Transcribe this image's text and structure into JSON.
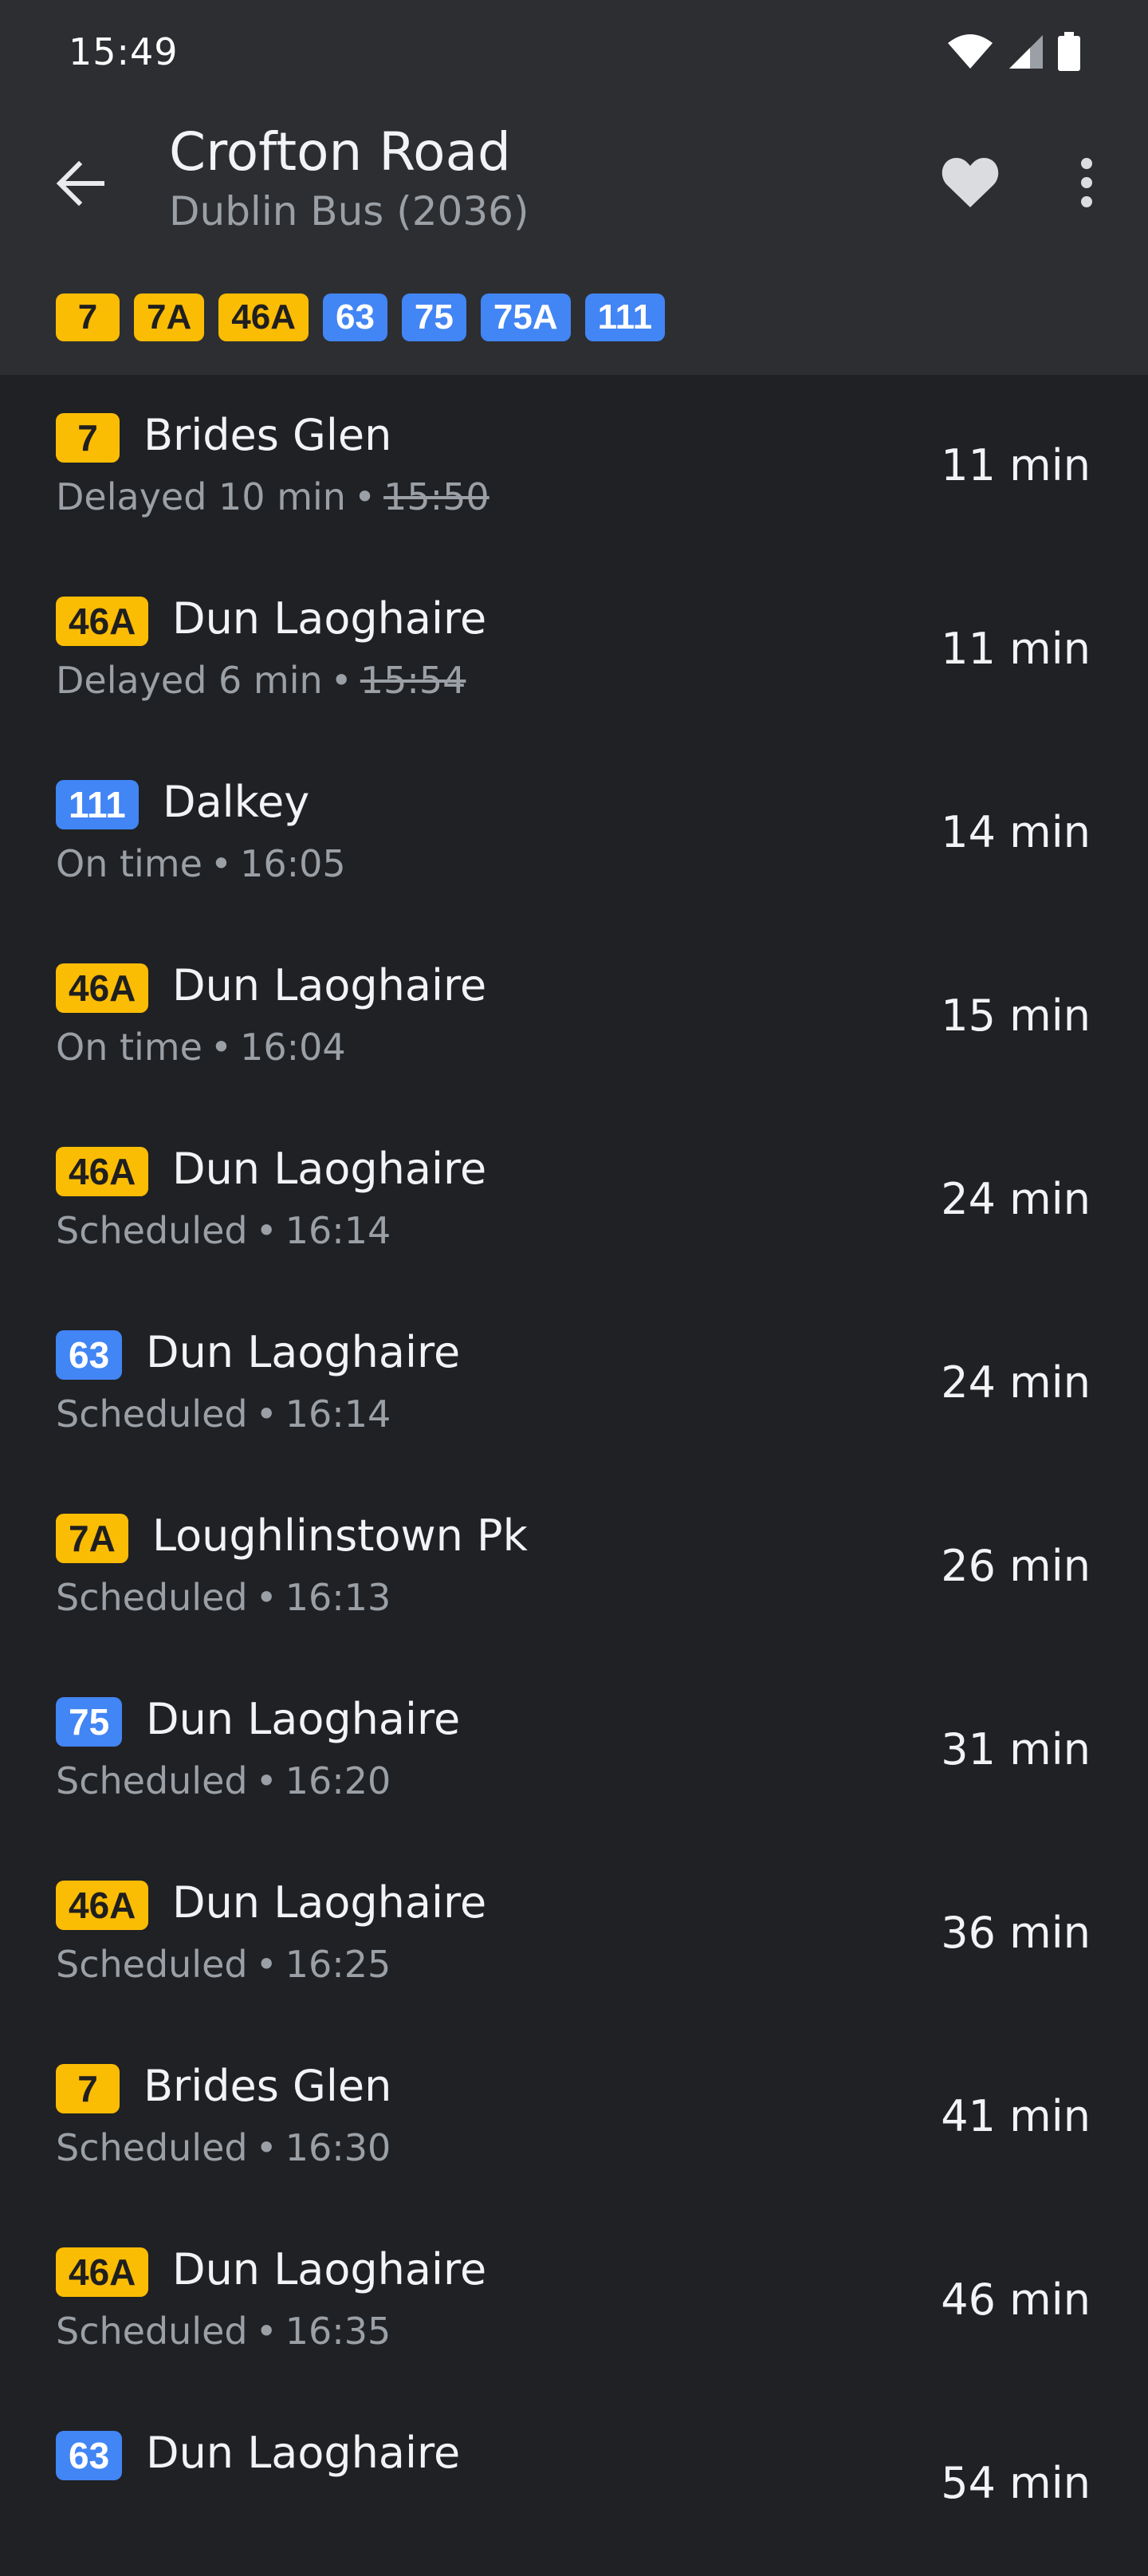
{
  "status_bar": {
    "time": "15:49",
    "icons": [
      "wifi-icon",
      "cell-signal-icon",
      "battery-icon"
    ]
  },
  "header": {
    "back_icon": "arrow-back-icon",
    "title": "Crofton Road",
    "subtitle": "Dublin Bus (2036)",
    "favorite_icon": "heart-icon",
    "more_icon": "more-vert-icon",
    "routes": [
      {
        "label": "7",
        "color": "yellow"
      },
      {
        "label": "7A",
        "color": "yellow"
      },
      {
        "label": "46A",
        "color": "yellow"
      },
      {
        "label": "63",
        "color": "blue"
      },
      {
        "label": "75",
        "color": "blue"
      },
      {
        "label": "75A",
        "color": "blue"
      },
      {
        "label": "111",
        "color": "blue"
      }
    ]
  },
  "colors": {
    "background": "#202124",
    "appbar": "#2d2e31",
    "route_yellow": "#fbbc04",
    "route_blue": "#4285f4",
    "secondary_text": "#9aa0a6"
  },
  "departures": [
    {
      "route": "7",
      "color": "yellow",
      "destination": "Brides Glen",
      "status": "Delayed 10 min",
      "time": "15:50",
      "time_struck": true,
      "due": "11 min"
    },
    {
      "route": "46A",
      "color": "yellow",
      "destination": "Dun Laoghaire",
      "status": "Delayed 6 min",
      "time": "15:54",
      "time_struck": true,
      "due": "11 min"
    },
    {
      "route": "111",
      "color": "blue",
      "destination": "Dalkey",
      "status": "On time",
      "time": "16:05",
      "time_struck": false,
      "due": "14 min"
    },
    {
      "route": "46A",
      "color": "yellow",
      "destination": "Dun Laoghaire",
      "status": "On time",
      "time": "16:04",
      "time_struck": false,
      "due": "15 min"
    },
    {
      "route": "46A",
      "color": "yellow",
      "destination": "Dun Laoghaire",
      "status": "Scheduled",
      "time": "16:14",
      "time_struck": false,
      "due": "24 min"
    },
    {
      "route": "63",
      "color": "blue",
      "destination": "Dun Laoghaire",
      "status": "Scheduled",
      "time": "16:14",
      "time_struck": false,
      "due": "24 min"
    },
    {
      "route": "7A",
      "color": "yellow",
      "destination": "Loughlinstown Pk",
      "status": "Scheduled",
      "time": "16:13",
      "time_struck": false,
      "due": "26 min"
    },
    {
      "route": "75",
      "color": "blue",
      "destination": "Dun Laoghaire",
      "status": "Scheduled",
      "time": "16:20",
      "time_struck": false,
      "due": "31 min"
    },
    {
      "route": "46A",
      "color": "yellow",
      "destination": "Dun Laoghaire",
      "status": "Scheduled",
      "time": "16:25",
      "time_struck": false,
      "due": "36 min"
    },
    {
      "route": "7",
      "color": "yellow",
      "destination": "Brides Glen",
      "status": "Scheduled",
      "time": "16:30",
      "time_struck": false,
      "due": "41 min"
    },
    {
      "route": "46A",
      "color": "yellow",
      "destination": "Dun Laoghaire",
      "status": "Scheduled",
      "time": "16:35",
      "time_struck": false,
      "due": "46 min"
    },
    {
      "route": "63",
      "color": "blue",
      "destination": "Dun Laoghaire",
      "status": "",
      "time": "",
      "time_struck": false,
      "due": "54 min"
    }
  ]
}
